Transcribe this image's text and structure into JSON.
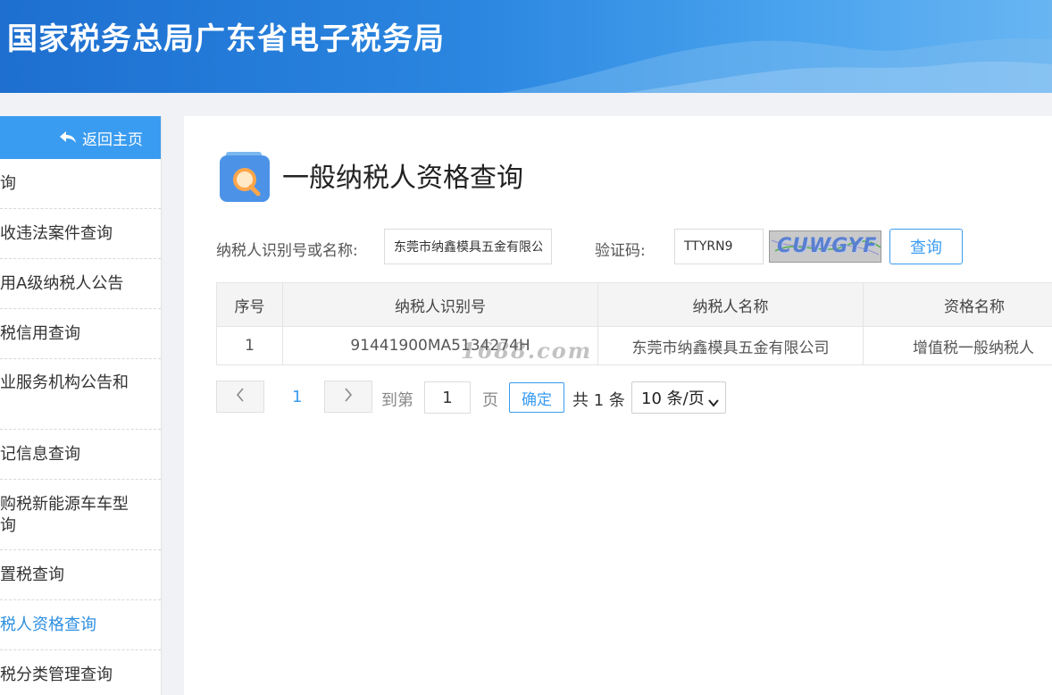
{
  "header": {
    "title": "国家税务总局广东省电子税务局"
  },
  "sidebar": {
    "back_label": "返回主页",
    "items": [
      {
        "lines": [
          "询"
        ]
      },
      {
        "lines": [
          "收违法案件查询"
        ]
      },
      {
        "lines": [
          "用A级纳税人公告"
        ]
      },
      {
        "lines": [
          "税信用查询"
        ]
      },
      {
        "lines": [
          "业服务机构公告和",
          ""
        ]
      },
      {
        "lines": [
          "记信息查询"
        ]
      },
      {
        "lines": [
          "购税新能源车车型",
          "询"
        ]
      },
      {
        "lines": [
          "置税查询"
        ]
      },
      {
        "lines": [
          "税人资格查询"
        ]
      },
      {
        "lines": [
          "税分类管理查询"
        ]
      }
    ]
  },
  "main": {
    "title": "一般纳税人资格查询",
    "form": {
      "taxpayer_label": "纳税人识别号或名称:",
      "taxpayer_value": "东莞市纳鑫模具五金有限公司",
      "captcha_label": "验证码:",
      "captcha_value": "TTYRN9",
      "captcha_image_text": "CUWGYF",
      "query_label": "查询"
    },
    "table": {
      "headers": [
        "序号",
        "纳税人识别号",
        "纳税人名称",
        "资格名称"
      ],
      "rows": [
        {
          "index": "1",
          "taxpayer_id": "91441900MA5134274H",
          "taxpayer_name": "东莞市纳鑫模具五金有限公司",
          "qualification": "增值税一般纳税人"
        }
      ]
    },
    "watermark": "1688.com",
    "pagination": {
      "current_page": "1",
      "goto_label": "到第",
      "goto_value": "1",
      "page_unit": "页",
      "confirm_label": "确定",
      "total_label": "共 1 条",
      "page_size": "10 条/页"
    }
  },
  "colors": {
    "accent": "#3a9cf0",
    "header_start": "#1e6fd0",
    "header_end": "#68b5f2"
  }
}
